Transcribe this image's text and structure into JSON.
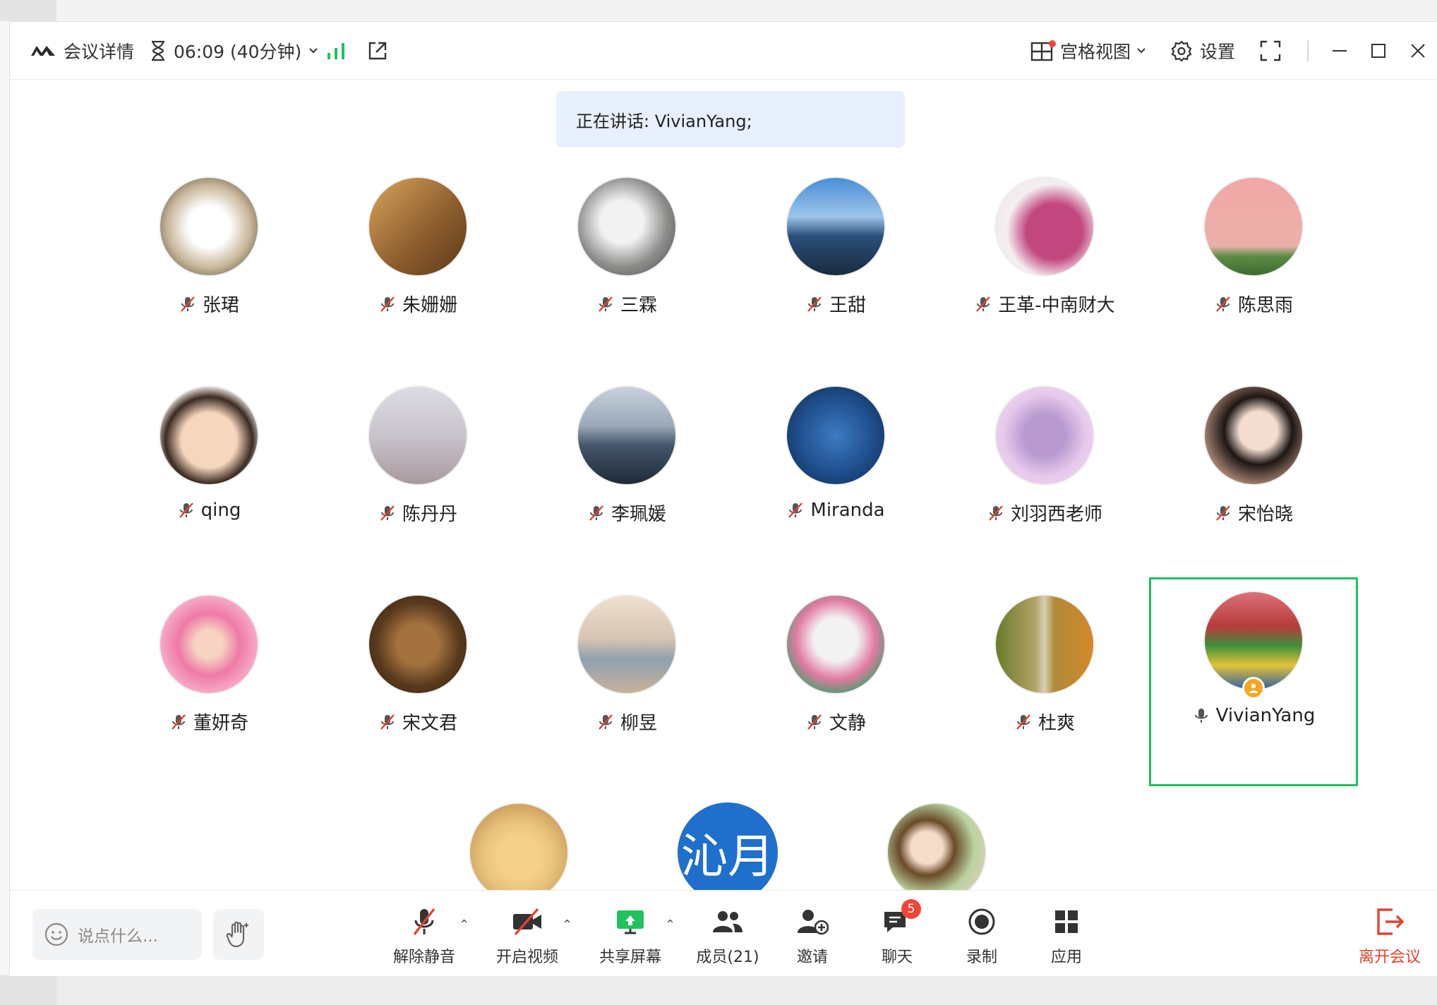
{
  "titlebar": {
    "meeting_details": "会议详情",
    "timer": "06:09 (40分钟)",
    "gallery_view": "宫格视图",
    "settings": "设置"
  },
  "speaking_banner": "正在讲话: VivianYang;",
  "participants": [
    {
      "name": "张珺",
      "mic": "muted",
      "avatar_color": "#c9b79b"
    },
    {
      "name": "朱姗姗",
      "mic": "muted",
      "avatar_color": "#b8884a"
    },
    {
      "name": "三霖",
      "mic": "muted",
      "avatar_color": "#9a9a98"
    },
    {
      "name": "王甜",
      "mic": "muted",
      "avatar_color": "#3a6fb0"
    },
    {
      "name": "王革-中南财大",
      "mic": "muted",
      "avatar_color": "#b3386b"
    },
    {
      "name": "陈思雨",
      "mic": "muted",
      "avatar_color": "#e8a3a3"
    },
    {
      "name": "qing",
      "mic": "muted",
      "avatar_color": "#d9b79a"
    },
    {
      "name": "陈丹丹",
      "mic": "muted",
      "avatar_color": "#c7c0c9"
    },
    {
      "name": "李珮媛",
      "mic": "muted",
      "avatar_color": "#6c88a8"
    },
    {
      "name": "Miranda",
      "mic": "muted",
      "avatar_color": "#1f4e8c"
    },
    {
      "name": "刘羽西老师",
      "mic": "muted",
      "avatar_color": "#d7b8de"
    },
    {
      "name": "宋怡晓",
      "mic": "muted",
      "avatar_color": "#c89a88"
    },
    {
      "name": "董妍奇",
      "mic": "muted",
      "avatar_color": "#ee7aa6"
    },
    {
      "name": "宋文君",
      "mic": "muted",
      "avatar_color": "#7a5234"
    },
    {
      "name": "柳昱",
      "mic": "muted",
      "avatar_color": "#c9b7a6"
    },
    {
      "name": "文静",
      "mic": "muted",
      "avatar_color": "#5c9a76"
    },
    {
      "name": "杜爽",
      "mic": "muted",
      "avatar_color": "#8f8a3c"
    },
    {
      "name": "VivianYang",
      "mic": "speaking",
      "avatar_color": "#b93b3b",
      "host": true
    }
  ],
  "partial_row": [
    {
      "avatar_color": "#e7c27a"
    },
    {
      "avatar_text": "沁月",
      "avatar_color": "#1f6fcd"
    },
    {
      "avatar_color": "#b9d3a0"
    }
  ],
  "toolbar": {
    "chat_placeholder": "说点什么...",
    "unmute": "解除静音",
    "start_video": "开启视频",
    "share_screen": "共享屏幕",
    "members": "成员(21)",
    "invite": "邀请",
    "chat": "聊天",
    "chat_badge": "5",
    "record": "录制",
    "apps": "应用",
    "leave": "离开会议"
  },
  "colors": {
    "accent_green": "#21c15d",
    "leave_red": "#e2442f",
    "banner_bg": "#e8effd"
  }
}
